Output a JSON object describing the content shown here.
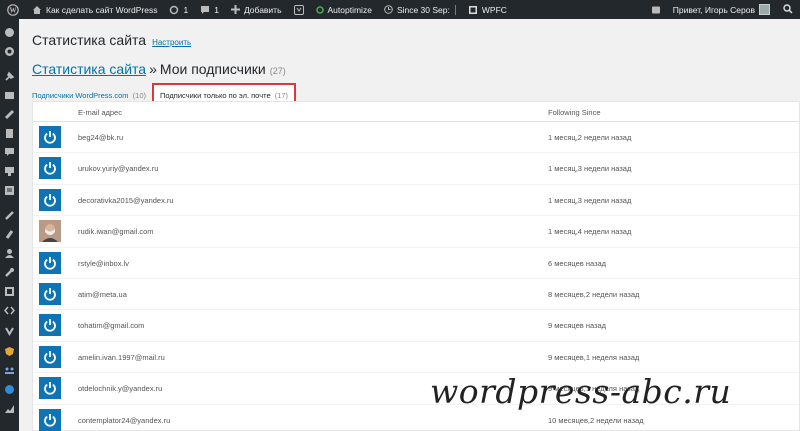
{
  "adminbar": {
    "site_name": "Как сделать сайт WordPress",
    "updates_count": "1",
    "comments_count": "1",
    "add_new": "Добавить",
    "autoptimize": "Autoptimize",
    "since": "Since 30 Sep:",
    "wpfc": "WPFC",
    "greeting": "Привет, Игорь Серов"
  },
  "page": {
    "title": "Статистика сайта",
    "settings_link": "Настроить"
  },
  "subheader": {
    "breadcrumb": "Статистика сайта",
    "separator": "»",
    "title": "Мои подписчики",
    "count": "(27)"
  },
  "tabs": [
    {
      "label": "Подписчики WordPress.com",
      "count": "(10)"
    },
    {
      "label": "Подписчики только по эл. почте",
      "count": "(17)"
    }
  ],
  "table": {
    "headers": {
      "email": "E-mail адрес",
      "since": "Following Since"
    },
    "rows": [
      {
        "email": "beg24@bk.ru",
        "since": "1 месяц,2 недели назад"
      },
      {
        "email": "urukov.yuriy@yandex.ru",
        "since": "1 месяц,3 недели назад"
      },
      {
        "email": "decorativka2015@yandex.ru",
        "since": "1 месяц,3 недели назад"
      },
      {
        "email": "rudik.iwan@gmail.com",
        "since": "1 месяц,4 недели назад"
      },
      {
        "email": "rstyle@inbox.lv",
        "since": "6 месяцев назад"
      },
      {
        "email": "atim@meta.ua",
        "since": "8 месяцев,2 недели назад"
      },
      {
        "email": "tohatim@gmail.com",
        "since": "9 месяцев назад"
      },
      {
        "email": "amelin.ivan.1997@mail.ru",
        "since": "9 месяцев,1 неделя назад"
      },
      {
        "email": "otdelochnik.y@yandex.ru",
        "since": "9 месяцев,1 неделя назад"
      },
      {
        "email": "contemplator24@yandex.ru",
        "since": "10 месяцев,2 недели назад"
      }
    ]
  },
  "watermark": "wordpress-abc.ru",
  "colors": {
    "adminbar": "#23282d",
    "link": "#0073aa",
    "highlight": "#d9393b",
    "avatar": "#0e74b5"
  }
}
